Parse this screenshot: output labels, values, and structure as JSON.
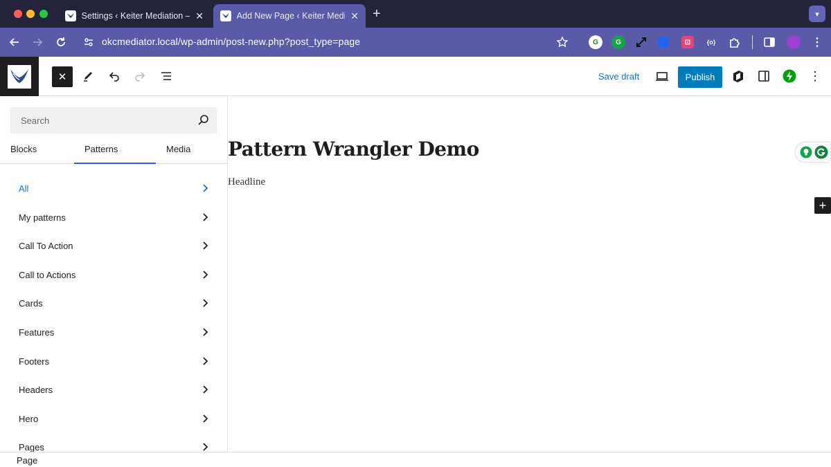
{
  "browser": {
    "tabs": [
      {
        "title": "Settings ‹ Keiter Mediation —",
        "active": false
      },
      {
        "title": "Add New Page ‹ Keiter Media…",
        "active": true
      }
    ],
    "url": "okcmediator.local/wp-admin/post-new.php?post_type=page",
    "extensions": [
      "grammarly-extension-icon",
      "grammarly-icon",
      "expand-icon",
      "blue-extension-icon",
      "pink-extension-icon",
      "code-extension-icon",
      "puzzle-icon",
      "sidebar-toggle-icon",
      "profile-avatar"
    ]
  },
  "editor_toolbar": {
    "save_draft_label": "Save draft",
    "publish_label": "Publish"
  },
  "inserter": {
    "search_placeholder": "Search",
    "tabs": [
      {
        "label": "Blocks",
        "active": false
      },
      {
        "label": "Patterns",
        "active": true
      },
      {
        "label": "Media",
        "active": false
      }
    ],
    "categories": [
      {
        "label": "All",
        "active": true
      },
      {
        "label": "My patterns",
        "active": false
      },
      {
        "label": "Call To Action",
        "active": false
      },
      {
        "label": "Call to Actions",
        "active": false
      },
      {
        "label": "Cards",
        "active": false
      },
      {
        "label": "Features",
        "active": false
      },
      {
        "label": "Footers",
        "active": false
      },
      {
        "label": "Headers",
        "active": false
      },
      {
        "label": "Hero",
        "active": false
      },
      {
        "label": "Pages",
        "active": false
      }
    ]
  },
  "canvas": {
    "page_title": "Pattern Wrangler Demo",
    "paragraph": "Headline"
  },
  "footer": {
    "breadcrumb": "Page"
  },
  "colors": {
    "tabbar_bg": "#23233a",
    "addressbar_bg": "#5a5aa8",
    "wp_blue": "#007cba",
    "link_blue": "#2271b1",
    "tab_indicator": "#3858e9"
  }
}
